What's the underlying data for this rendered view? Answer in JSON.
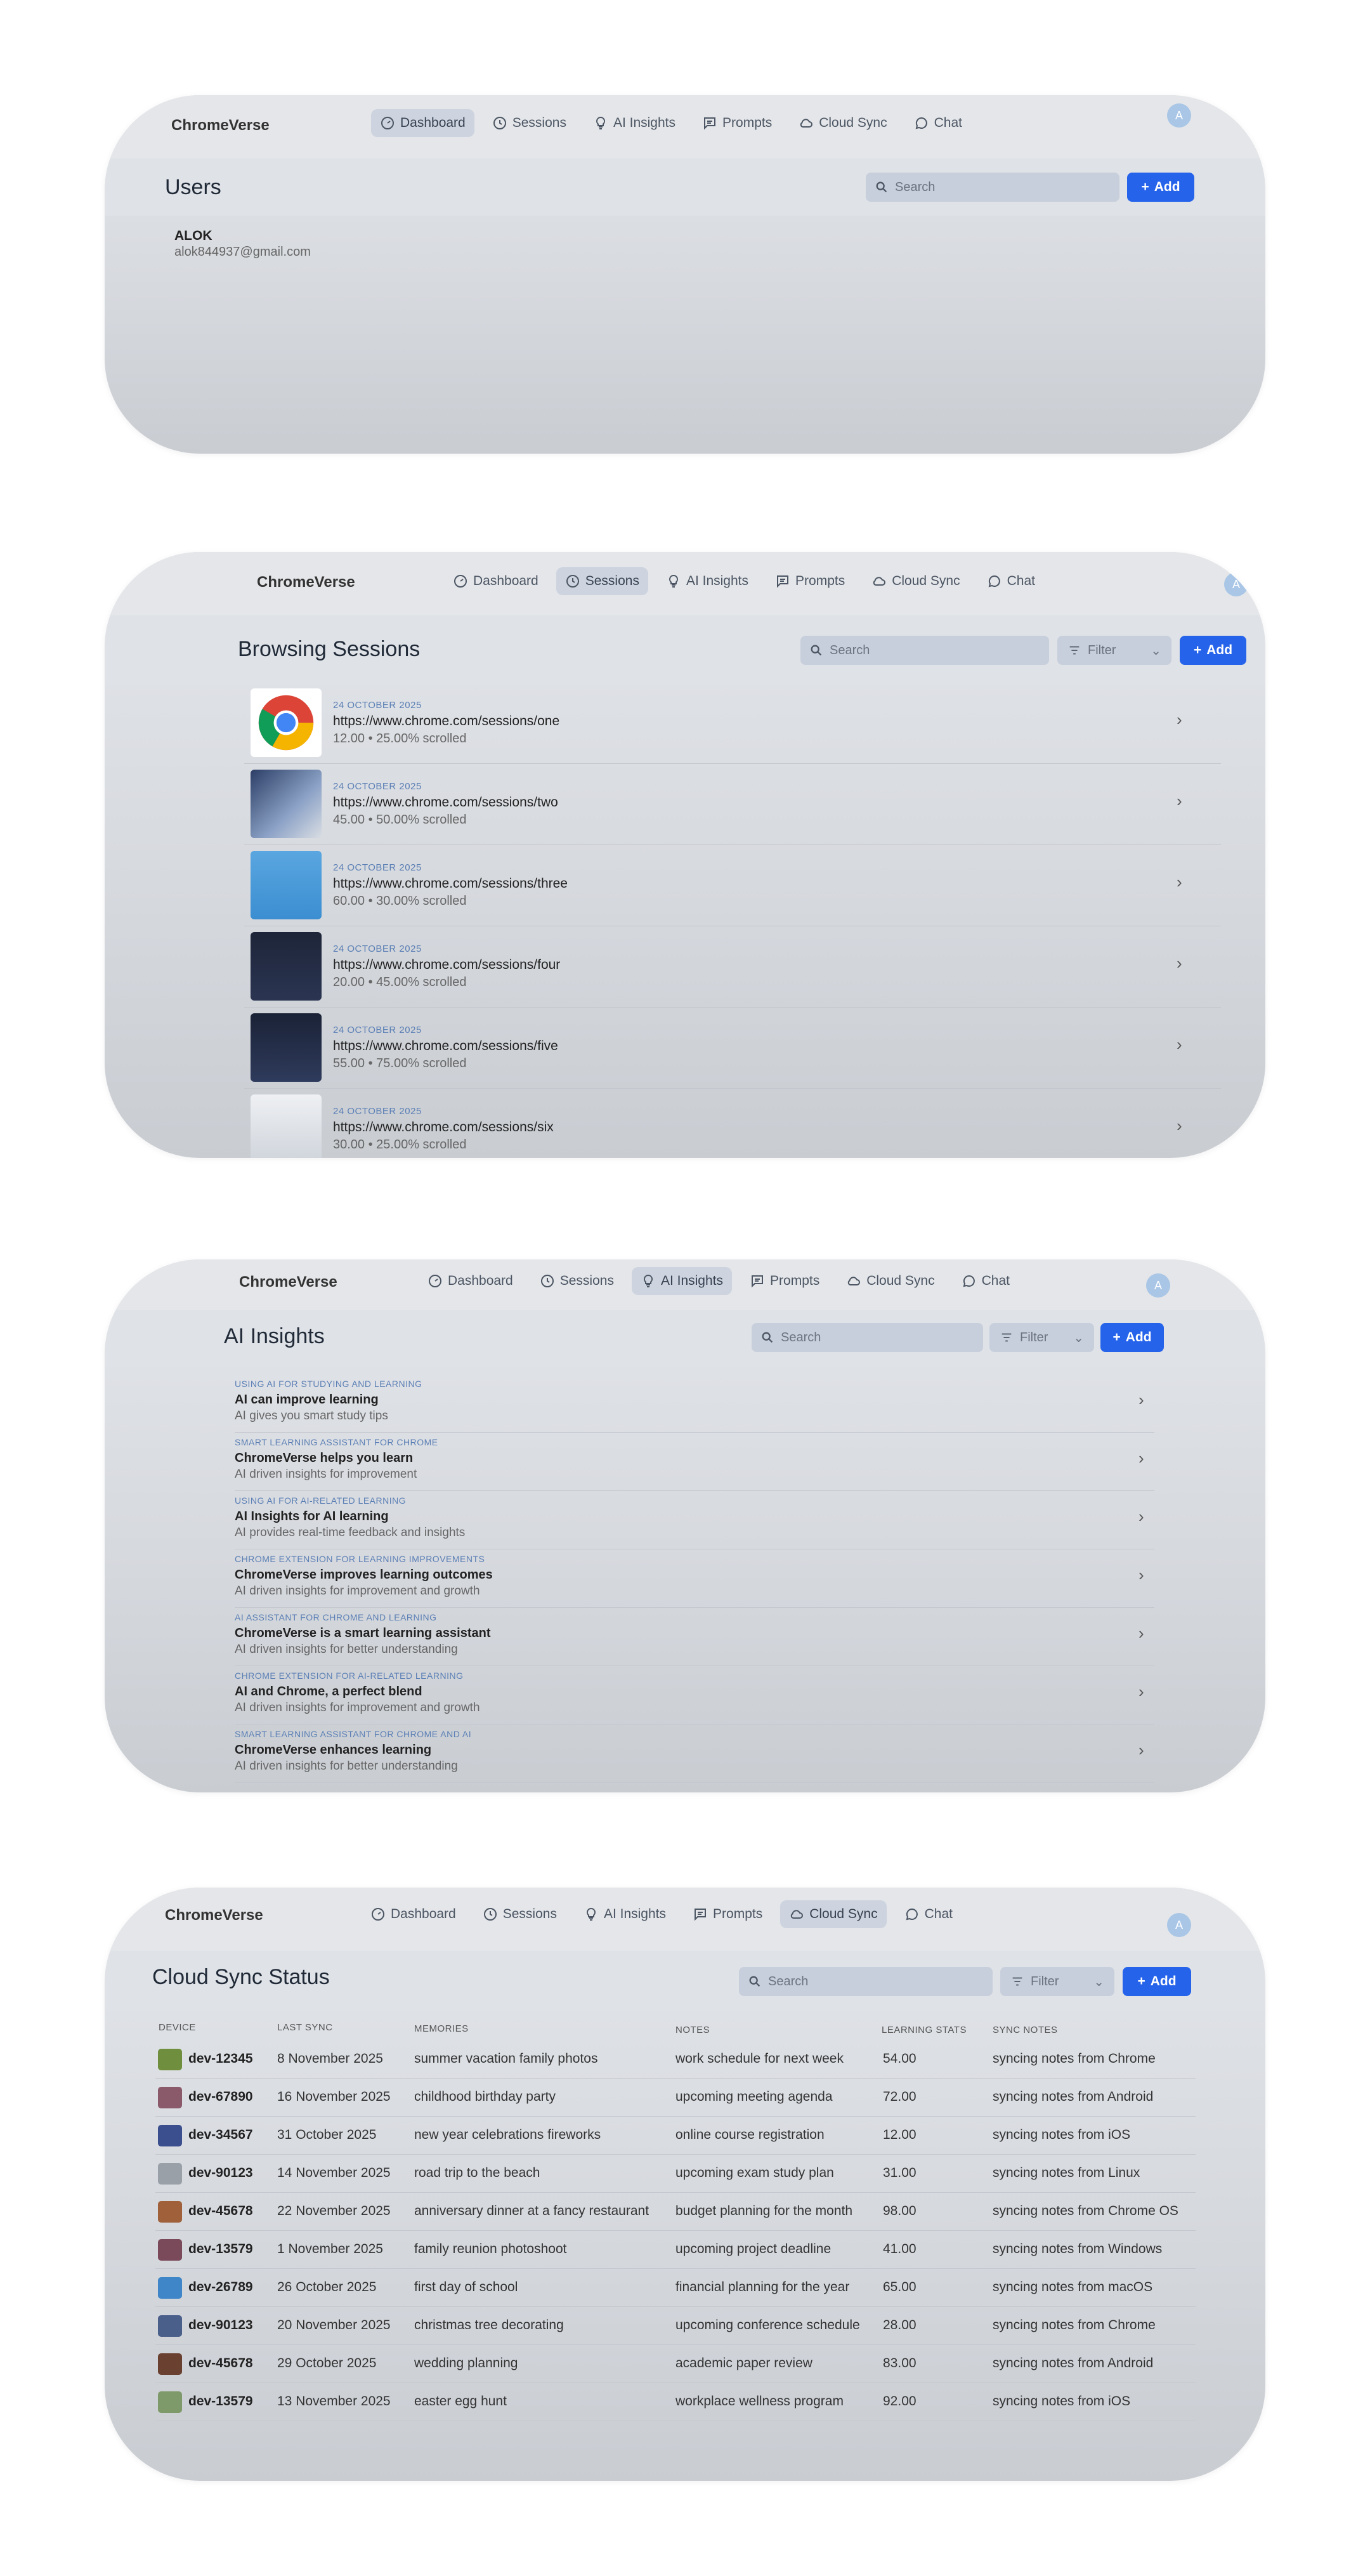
{
  "brand": "ChromeVerse",
  "nav": {
    "dashboard": "Dashboard",
    "sessions": "Sessions",
    "insights": "AI Insights",
    "prompts": "Prompts",
    "cloud": "Cloud Sync",
    "chat": "Chat"
  },
  "avatar_letter": "A",
  "search_placeholder": "Search",
  "filter_label": "Filter",
  "add_label": "Add",
  "users": {
    "title": "Users",
    "name": "ALOK",
    "email": "alok844937@gmail.com"
  },
  "sessions": {
    "title": "Browsing Sessions",
    "items": [
      {
        "date": "24 OCTOBER 2025",
        "url": "https://www.chrome.com/sessions/one",
        "meta": "12.00 • 25.00% scrolled"
      },
      {
        "date": "24 OCTOBER 2025",
        "url": "https://www.chrome.com/sessions/two",
        "meta": "45.00 • 50.00% scrolled"
      },
      {
        "date": "24 OCTOBER 2025",
        "url": "https://www.chrome.com/sessions/three",
        "meta": "60.00 • 30.00% scrolled"
      },
      {
        "date": "24 OCTOBER 2025",
        "url": "https://www.chrome.com/sessions/four",
        "meta": "20.00 • 45.00% scrolled"
      },
      {
        "date": "24 OCTOBER 2025",
        "url": "https://www.chrome.com/sessions/five",
        "meta": "55.00 • 75.00% scrolled"
      },
      {
        "date": "24 OCTOBER 2025",
        "url": "https://www.chrome.com/sessions/six",
        "meta": "30.00 • 25.00% scrolled"
      }
    ]
  },
  "insights": {
    "title": "AI Insights",
    "items": [
      {
        "category": "USING AI FOR STUDYING AND LEARNING",
        "title": "AI can improve learning",
        "desc": "AI gives you smart study tips"
      },
      {
        "category": "SMART LEARNING ASSISTANT FOR CHROME",
        "title": "ChromeVerse helps you learn",
        "desc": "AI driven insights for improvement"
      },
      {
        "category": "USING AI FOR AI-RELATED LEARNING",
        "title": "AI Insights for AI learning",
        "desc": "AI provides real-time feedback and insights"
      },
      {
        "category": "CHROME EXTENSION FOR LEARNING IMPROVEMENTS",
        "title": "ChromeVerse improves learning outcomes",
        "desc": "AI driven insights for improvement and growth"
      },
      {
        "category": "AI ASSISTANT FOR CHROME AND LEARNING",
        "title": "ChromeVerse is a smart learning assistant",
        "desc": "AI driven insights for better understanding"
      },
      {
        "category": "CHROME EXTENSION FOR AI-RELATED LEARNING",
        "title": "AI and Chrome, a perfect blend",
        "desc": "AI driven insights for improvement and growth"
      },
      {
        "category": "SMART LEARNING ASSISTANT FOR CHROME AND AI",
        "title": "ChromeVerse enhances learning",
        "desc": "AI driven insights for better understanding"
      }
    ]
  },
  "cloud": {
    "title": "Cloud Sync Status",
    "headers": {
      "device": "DEVICE",
      "last_sync": "LAST SYNC",
      "memories": "MEMORIES",
      "notes": "NOTES",
      "stats": "LEARNING STATS",
      "sync_notes": "SYNC NOTES"
    },
    "rows": [
      {
        "device": "dev-12345",
        "last_sync": "8 November 2025",
        "memory": "summer vacation family photos",
        "note": "work schedule for next week",
        "stats": "54.00",
        "sync": "syncing notes from Chrome",
        "color": "#6f8f3f"
      },
      {
        "device": "dev-67890",
        "last_sync": "16 November 2025",
        "memory": "childhood birthday party",
        "note": "upcoming meeting agenda",
        "stats": "72.00",
        "sync": "syncing notes from Android",
        "color": "#8a5a6a"
      },
      {
        "device": "dev-34567",
        "last_sync": "31 October 2025",
        "memory": "new year celebrations fireworks",
        "note": "online course registration",
        "stats": "12.00",
        "sync": "syncing notes from iOS",
        "color": "#3b4f8f"
      },
      {
        "device": "dev-90123",
        "last_sync": "14 November 2025",
        "memory": "road trip to the beach",
        "note": "upcoming exam study plan",
        "stats": "31.00",
        "sync": "syncing notes from Linux",
        "color": "#9aa0a8"
      },
      {
        "device": "dev-45678",
        "last_sync": "22 November 2025",
        "memory": "anniversary dinner at a fancy restaurant",
        "note": "budget planning for the month",
        "stats": "98.00",
        "sync": "syncing notes from Chrome OS",
        "color": "#a0603a"
      },
      {
        "device": "dev-13579",
        "last_sync": "1 November 2025",
        "memory": "family reunion photoshoot",
        "note": "upcoming project deadline",
        "stats": "41.00",
        "sync": "syncing notes from Windows",
        "color": "#7a4a5a"
      },
      {
        "device": "dev-26789",
        "last_sync": "26 October 2025",
        "memory": "first day of school",
        "note": "financial planning for the year",
        "stats": "65.00",
        "sync": "syncing notes from macOS",
        "color": "#3f86c8"
      },
      {
        "device": "dev-90123",
        "last_sync": "20 November 2025",
        "memory": "christmas tree decorating",
        "note": "upcoming conference schedule",
        "stats": "28.00",
        "sync": "syncing notes from Chrome",
        "color": "#4a5f8a"
      },
      {
        "device": "dev-45678",
        "last_sync": "29 October 2025",
        "memory": "wedding planning",
        "note": "academic paper review",
        "stats": "83.00",
        "sync": "syncing notes from Android",
        "color": "#6a4030"
      },
      {
        "device": "dev-13579",
        "last_sync": "13 November 2025",
        "memory": "easter egg hunt",
        "note": "workplace wellness program",
        "stats": "92.00",
        "sync": "syncing notes from iOS",
        "color": "#7f9a6a"
      }
    ]
  }
}
